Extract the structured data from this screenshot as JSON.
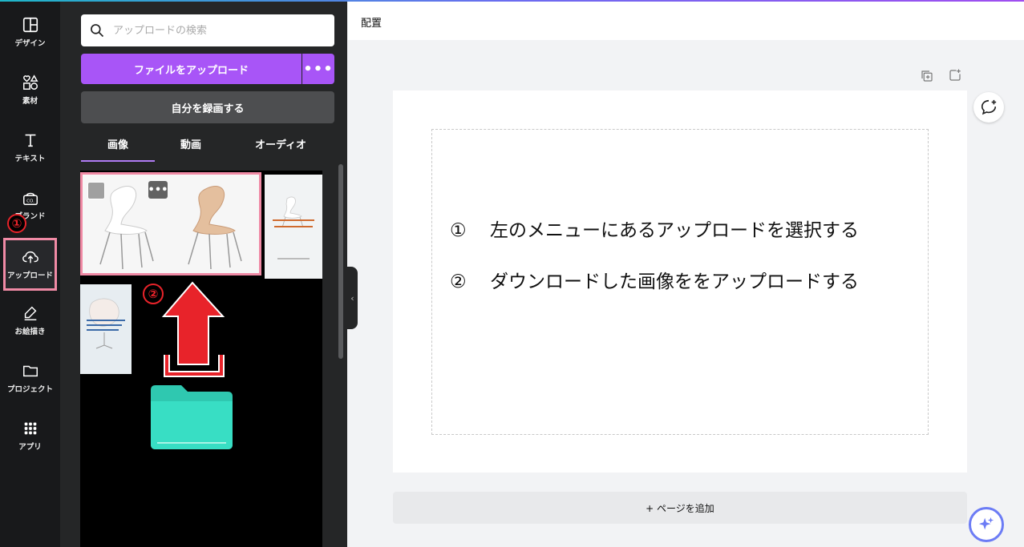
{
  "rail": {
    "items": [
      {
        "label": "デザイン",
        "icon": "layout-icon"
      },
      {
        "label": "素材",
        "icon": "shapes-icon"
      },
      {
        "label": "テキスト",
        "icon": "text-icon"
      },
      {
        "label": "ブランド",
        "icon": "brand-icon"
      },
      {
        "label": "アップロード",
        "icon": "cloud-upload-icon"
      },
      {
        "label": "お絵描き",
        "icon": "draw-icon"
      },
      {
        "label": "プロジェクト",
        "icon": "folder-icon"
      },
      {
        "label": "アプリ",
        "icon": "apps-grid-icon"
      }
    ],
    "annotation_1": "①"
  },
  "panel": {
    "search_placeholder": "アップロードの検索",
    "upload_button": "ファイルをアップロード",
    "more_button": "•••",
    "record_button": "自分を録画する",
    "tabs": [
      {
        "label": "画像"
      },
      {
        "label": "動画"
      },
      {
        "label": "オーディオ"
      }
    ],
    "thumb_more": "•••",
    "annotation_2": "②",
    "collapse_glyph": "‹"
  },
  "editor": {
    "title": "配置",
    "lines": [
      {
        "num": "①",
        "text": "左のメニューにあるアップロードを選択する"
      },
      {
        "num": "②",
        "text": "ダウンロードした画像ををアップロードする"
      }
    ],
    "add_page": "+ ページを追加"
  },
  "colors": {
    "accent": "#a855f7",
    "highlight": "#f08aa5",
    "annotation_red": "#e8232a",
    "folder": "#38dec4"
  }
}
